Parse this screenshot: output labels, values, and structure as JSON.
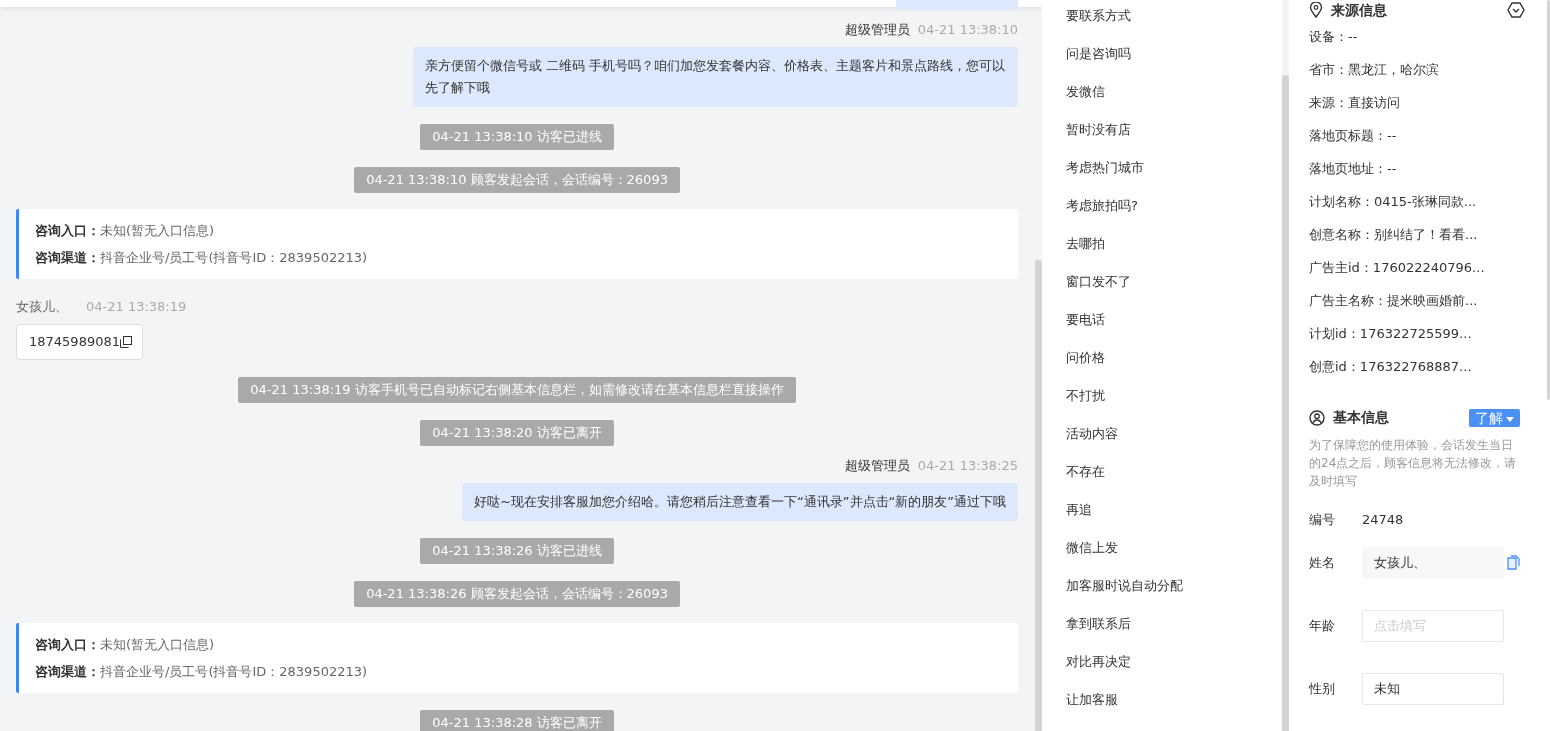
{
  "chat": {
    "messages": [
      {
        "kind": "bubble_partial"
      },
      {
        "kind": "agent",
        "sender": "超级管理员",
        "time": "04-21 13:38:10",
        "text": "亲方便留个微信号或 二维码 手机号吗？咱们加您发套餐内容、价格表、主题客片和景点路线，您可以先了解下哦"
      },
      {
        "kind": "system",
        "text": "04-21 13:38:10 访客已进线"
      },
      {
        "kind": "system",
        "text": "04-21 13:38:10 顾客发起会话，会话编号：26093"
      },
      {
        "kind": "entry",
        "rows": [
          {
            "label": "咨询入口：",
            "value": "未知(暂无入口信息)"
          },
          {
            "label": "咨询渠道：",
            "value": "抖音企业号/员工号(抖音号ID：2839502213)"
          }
        ]
      },
      {
        "kind": "visitor",
        "sender": "女孩儿、",
        "time": "04-21 13:38:19",
        "text": "18745989081"
      },
      {
        "kind": "system",
        "text": "04-21 13:38:19 访客手机号已自动标记右侧基本信息栏，如需修改请在基本信息栏直接操作"
      },
      {
        "kind": "system",
        "text": "04-21 13:38:20 访客已离开"
      },
      {
        "kind": "agent",
        "sender": "超级管理员",
        "time": "04-21 13:38:25",
        "text": "好哒~现在安排客服加您介绍哈。请您稍后注意查看一下“通讯录”并点击“新的朋友”通过下哦"
      },
      {
        "kind": "system",
        "text": "04-21 13:38:26 访客已进线"
      },
      {
        "kind": "system",
        "text": "04-21 13:38:26 顾客发起会话，会话编号：26093"
      },
      {
        "kind": "entry",
        "rows": [
          {
            "label": "咨询入口：",
            "value": "未知(暂无入口信息)"
          },
          {
            "label": "咨询渠道：",
            "value": "抖音企业号/员工号(抖音号ID：2839502213)"
          }
        ]
      },
      {
        "kind": "system",
        "text": "04-21 13:38:28 访客已离开"
      }
    ]
  },
  "quick_replies": [
    "要联系方式",
    "问是咨询吗",
    "发微信",
    "暂时没有店",
    "考虑热门城市",
    "考虑旅拍吗?",
    "去哪拍",
    "窗口发不了",
    "要电话",
    "问价格",
    "不打扰",
    "活动内容",
    "不存在",
    "再追",
    "微信上发",
    "加客服时说自动分配",
    "拿到联系后",
    "对比再决定",
    "让加客服"
  ],
  "source_info": {
    "title": "来源信息",
    "rows": [
      "设备：--",
      "省市：黑龙江，哈尔滨",
      "来源：直接访问",
      "落地页标题：--",
      "落地页地址：--",
      "计划名称：0415-张琳同款...",
      "创意名称：别纠结了！看看...",
      "广告主id：176022240796...",
      "广告主名称：提米映画婚前...",
      "计划id：176322725599...",
      "创意id：176322768887..."
    ]
  },
  "basic_info": {
    "title": "基本信息",
    "dropdown": "了解",
    "note": "为了保障您的使用体验，会话发生当日的24点之后，顾客信息将无法修改，请及时填写",
    "fields": [
      {
        "kind": "text",
        "label": "编号",
        "value": "24748"
      },
      {
        "kind": "readonly",
        "label": "姓名",
        "value": "女孩儿、",
        "copy": true
      },
      {
        "kind": "input",
        "label": "年龄",
        "placeholder": "点击填写"
      },
      {
        "kind": "input",
        "label": "性别",
        "value": "未知"
      }
    ]
  }
}
